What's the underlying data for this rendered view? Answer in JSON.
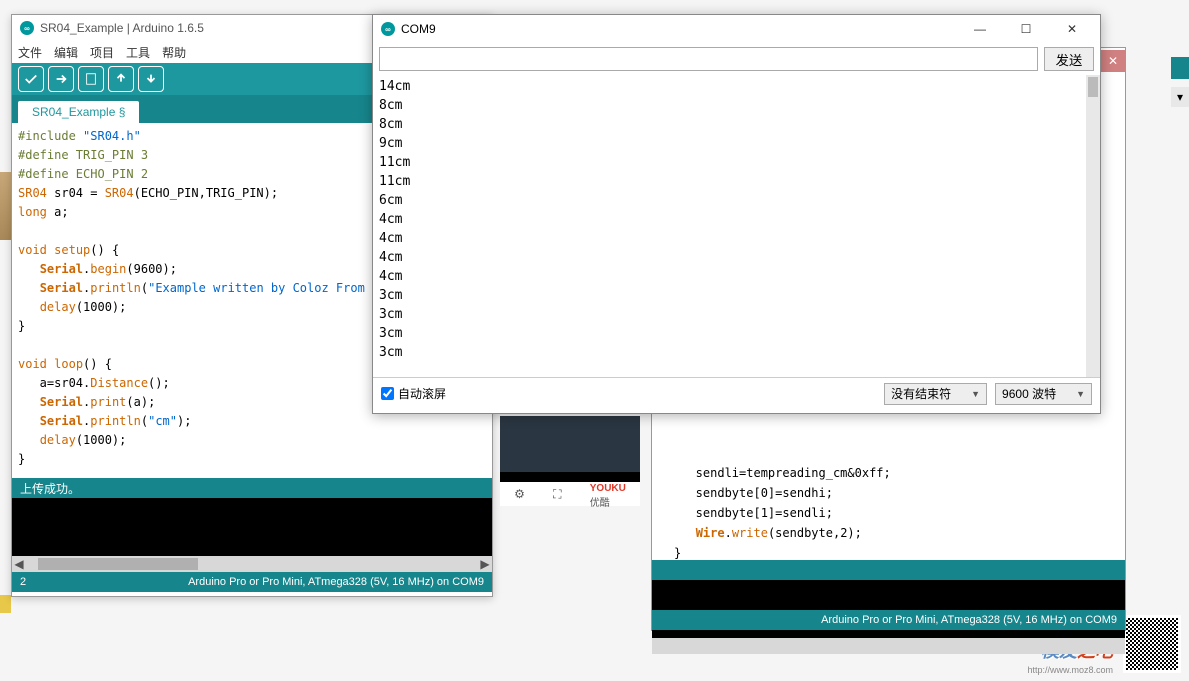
{
  "arduino": {
    "title": "SR04_Example | Arduino 1.6.5",
    "menu": [
      "文件",
      "编辑",
      "项目",
      "工具",
      "帮助"
    ],
    "tab": "SR04_Example §",
    "status": "上传成功。",
    "footer_left": "2",
    "footer_right": "Arduino Pro or Pro Mini, ATmega328 (5V, 16 MHz) on COM9",
    "code": {
      "l1_inc": "#include ",
      "l1_hdr": "\"SR04.h\"",
      "l2": "#define TRIG_PIN 3",
      "l3": "#define ECHO_PIN 2",
      "l4a": "SR04",
      "l4b": " sr04 = ",
      "l4c": "SR04",
      "l4d": "(ECHO_PIN,TRIG_PIN);",
      "l5a": "long",
      "l5b": " a;",
      "l7a": "void",
      "l7b": " ",
      "l7c": "setup",
      "l7d": "() {",
      "l8a": "   ",
      "l8b": "Serial",
      "l8c": ".",
      "l8d": "begin",
      "l8e": "(9600);",
      "l9a": "   ",
      "l9b": "Serial",
      "l9c": ".",
      "l9d": "println",
      "l9e": "(",
      "l9f": "\"Example written by Coloz From Arduin.CN\"",
      "l9g": ");",
      "l10a": "   ",
      "l10b": "delay",
      "l10c": "(1000);",
      "l11": "}",
      "l13a": "void",
      "l13b": " ",
      "l13c": "loop",
      "l13d": "() {",
      "l14a": "   a=sr04.",
      "l14b": "Distance",
      "l14c": "();",
      "l15a": "   ",
      "l15b": "Serial",
      "l15c": ".",
      "l15d": "print",
      "l15e": "(a);",
      "l16a": "   ",
      "l16b": "Serial",
      "l16c": ".",
      "l16d": "println",
      "l16e": "(",
      "l16f": "\"cm\"",
      "l16g": ");",
      "l17a": "   ",
      "l17b": "delay",
      "l17c": "(1000);",
      "l18": "}"
    }
  },
  "serial": {
    "title": "COM9",
    "send": "发送",
    "lines": [
      "14cm",
      "8cm",
      "8cm",
      "9cm",
      "11cm",
      "11cm",
      "6cm",
      "4cm",
      "4cm",
      "4cm",
      "4cm",
      "3cm",
      "3cm",
      "3cm",
      "3cm"
    ],
    "autoscroll": "自动滚屏",
    "line_ending": "没有结束符",
    "baud": "9600 波特"
  },
  "arduino2": {
    "footer": "Arduino Pro or Pro Mini, ATmega328 (5V, 16 MHz) on COM9",
    "code": {
      "l1": "   sendli=tempreading_cm&0xff;",
      "l2": "   sendbyte[0]=sendhi;",
      "l3": "   sendbyte[1]=sendli;",
      "l4a": "   ",
      "l4b": "Wire",
      "l4c": ".",
      "l4d": "write",
      "l4e": "(sendbyte,2);",
      "l5": "}"
    }
  },
  "watermark": {
    "brand_a": "模友",
    "brand_b": "之吧",
    "url": "http://www.moz8.com"
  },
  "youku": {
    "en": "YOUKU",
    "cn": "优酷"
  }
}
